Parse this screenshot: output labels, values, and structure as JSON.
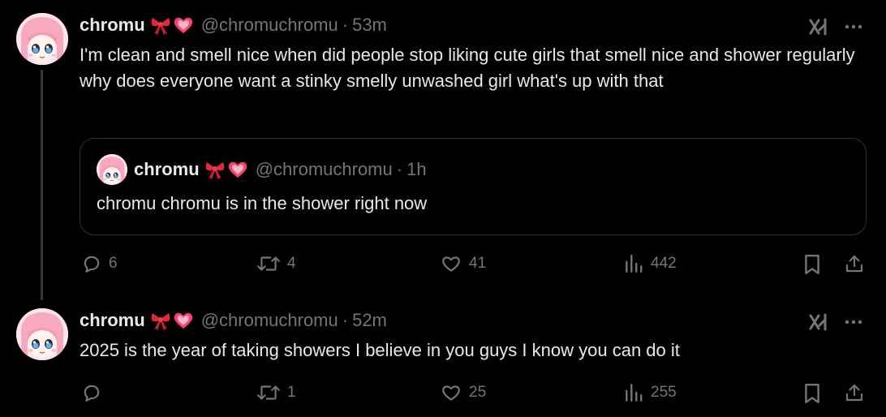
{
  "tweets": [
    {
      "name": "chromu",
      "handle": "@chromuchromu",
      "time": "53m",
      "text": "I'm clean and smell nice when did people stop liking cute girls that smell nice and shower regularly why does everyone want a stinky smelly unwashed girl what's up with that",
      "quote": {
        "name": "chromu",
        "handle": "@chromuchromu",
        "time": "1h",
        "text": "chromu chromu is in the shower right now"
      },
      "actions": {
        "replies": "6",
        "reposts": "4",
        "likes": "41",
        "views": "442"
      }
    },
    {
      "name": "chromu",
      "handle": "@chromuchromu",
      "time": "52m",
      "text": "2025 is the year of taking showers I believe in you guys I know you can do it",
      "actions": {
        "replies": "",
        "reposts": "1",
        "likes": "25",
        "views": "255"
      }
    }
  ],
  "separator": "·",
  "icons": {
    "name_emoji_1": "ribbon-emoji",
    "name_emoji_2": "heart-emoji",
    "grok": "grok-icon",
    "more": "more-icon",
    "reply": "reply-icon",
    "repost": "repost-icon",
    "like": "like-icon",
    "views": "views-icon",
    "bookmark": "bookmark-icon",
    "share": "share-icon"
  },
  "colors": {
    "background": "#000000",
    "text": "#e7e9ea",
    "muted": "#71767b",
    "border": "#2f3336"
  }
}
